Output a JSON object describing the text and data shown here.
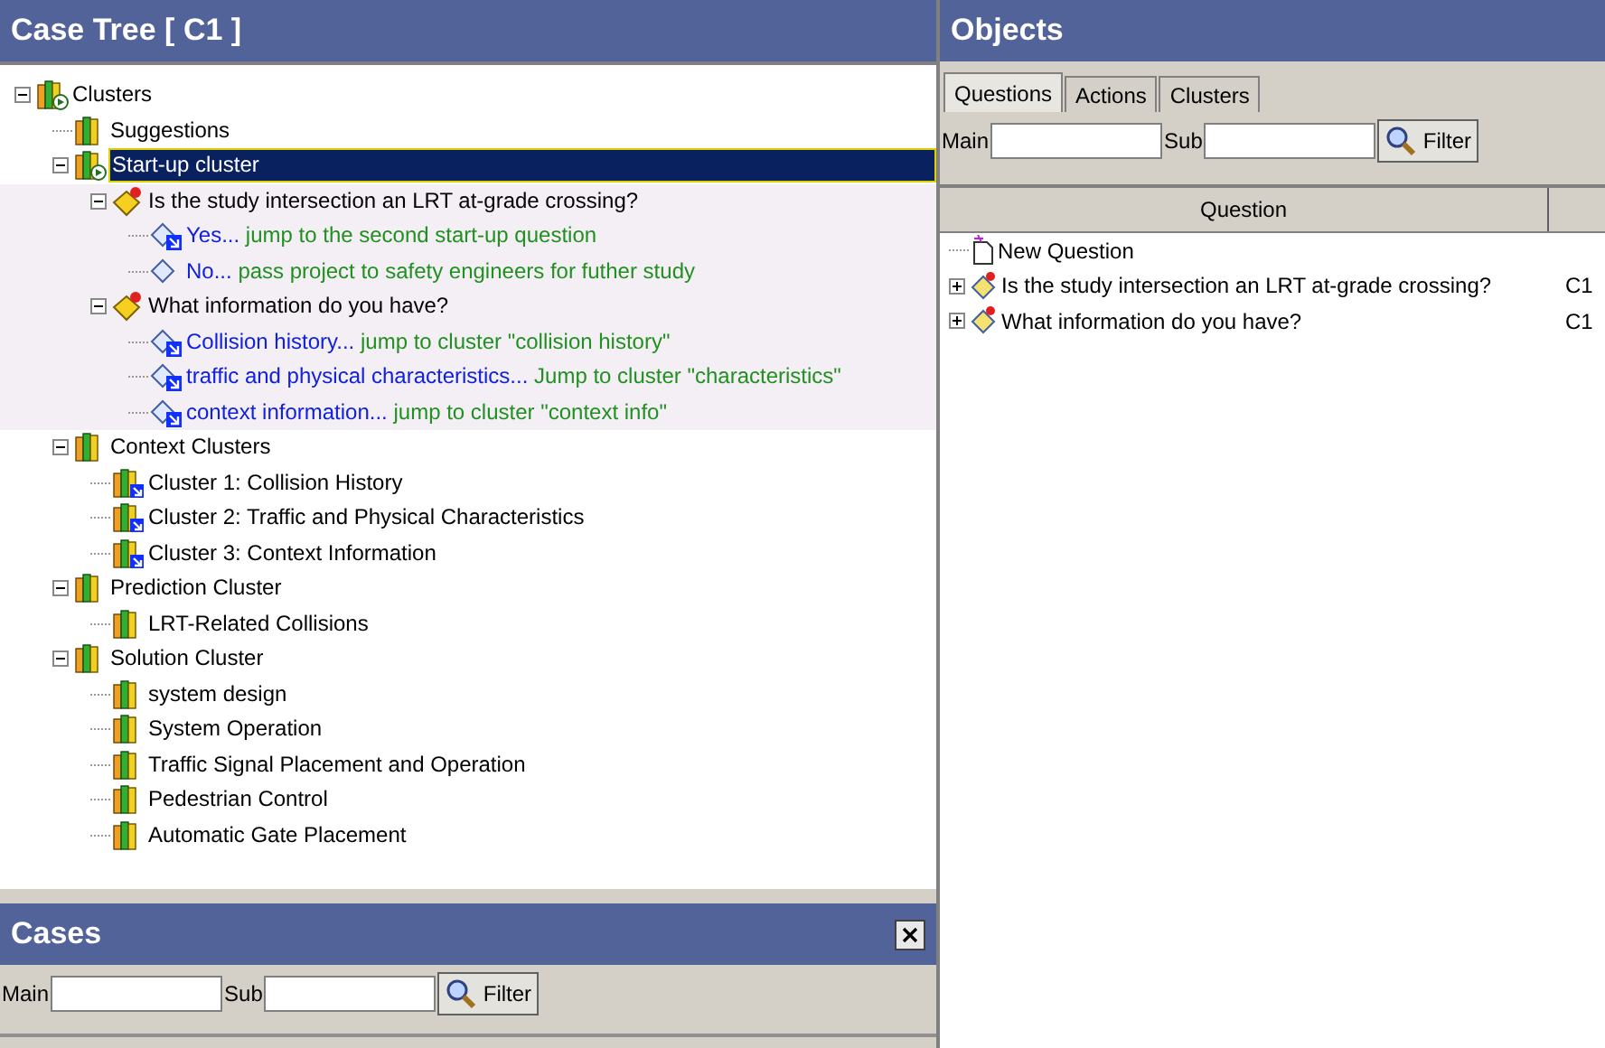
{
  "case_tree": {
    "title": "Case Tree  [ C1 ]",
    "nodes": [
      {
        "kind": "start",
        "label": "Clusters",
        "selected": false,
        "expanded": true,
        "children": [
          {
            "kind": "cluster",
            "label": "Suggestions",
            "selected": false
          },
          {
            "kind": "start",
            "label": "Start-up cluster",
            "selected": true,
            "expanded": true,
            "children": [
              {
                "kind": "question",
                "label": "Is the study intersection an LRT at-grade crossing?",
                "selected": false,
                "expanded": true,
                "children": [
                  {
                    "kind": "answer",
                    "label": "Yes...",
                    "action": "jump to the second start-up question",
                    "selected": false,
                    "link": true
                  },
                  {
                    "kind": "answer",
                    "label": "No...",
                    "action": "pass project to safety engineers for futher study",
                    "selected": false,
                    "link": false
                  }
                ]
              },
              {
                "kind": "question",
                "label": "What information do you have?",
                "selected": false,
                "expanded": true,
                "children": [
                  {
                    "kind": "answer",
                    "label": "Collision history...",
                    "action": "jump to cluster \"collision history\"",
                    "selected": false,
                    "link": true
                  },
                  {
                    "kind": "answer",
                    "label": "traffic and physical characteristics...",
                    "action": "Jump to cluster \"characteristics\"",
                    "selected": false,
                    "link": true
                  },
                  {
                    "kind": "answer",
                    "label": "context information...",
                    "action": "jump to cluster \"context info\"",
                    "selected": false,
                    "link": true
                  }
                ]
              }
            ]
          },
          {
            "kind": "cluster",
            "label": "Context Clusters",
            "selected": false,
            "expanded": true,
            "children": [
              {
                "kind": "linked",
                "label": "Cluster 1: Collision History",
                "selected": false
              },
              {
                "kind": "linked",
                "label": "Cluster 2: Traffic and Physical Characteristics",
                "selected": false
              },
              {
                "kind": "linked",
                "label": "Cluster 3: Context Information",
                "selected": false
              }
            ]
          },
          {
            "kind": "cluster",
            "label": "Prediction Cluster",
            "selected": false,
            "expanded": true,
            "children": [
              {
                "kind": "cluster",
                "label": "LRT-Related Collisions",
                "selected": false
              }
            ]
          },
          {
            "kind": "cluster",
            "label": "Solution Cluster",
            "selected": false,
            "expanded": true,
            "children": [
              {
                "kind": "cluster",
                "label": "system design",
                "selected": false
              },
              {
                "kind": "cluster",
                "label": "System Operation",
                "selected": false
              },
              {
                "kind": "cluster",
                "label": "Traffic Signal Placement and Operation",
                "selected": false
              },
              {
                "kind": "cluster",
                "label": "Pedestrian Control",
                "selected": false
              },
              {
                "kind": "cluster",
                "label": "Automatic Gate Placement",
                "selected": false
              }
            ]
          }
        ]
      }
    ]
  },
  "cases": {
    "title": "Cases",
    "main_label": "Main",
    "sub_label": "Sub",
    "filter_button": "Filter"
  },
  "objects": {
    "title": "Objects",
    "tabs": [
      {
        "label": "Questions",
        "selected": true
      },
      {
        "label": "Actions",
        "selected": false
      },
      {
        "label": "Clusters",
        "selected": false
      }
    ],
    "main_label": "Main",
    "sub_label": "Sub",
    "filter_button": "Filter",
    "columns": [
      "Question"
    ],
    "rows": [
      {
        "kind": "new",
        "text": "New Question"
      },
      {
        "kind": "question",
        "text": "Is the study intersection an LRT at-grade crossing?",
        "column_2": "C1",
        "expanded": false
      },
      {
        "kind": "question",
        "text": "What information do you have?",
        "column_2": "C1",
        "expanded": false
      }
    ]
  }
}
